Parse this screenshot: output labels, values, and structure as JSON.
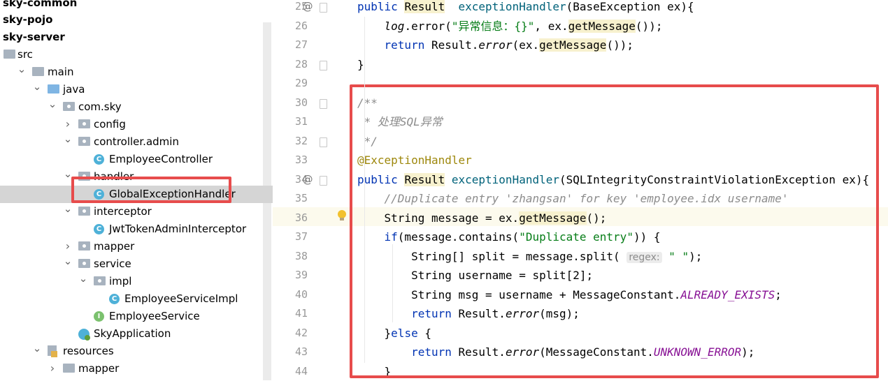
{
  "tree": [
    {
      "label": "sky-common",
      "bold": true
    },
    {
      "label": "sky-pojo",
      "bold": true
    },
    {
      "label": "sky-server",
      "bold": true
    },
    {
      "label": "src",
      "icon": "folder"
    },
    {
      "label": "main",
      "icon": "folder",
      "arrow": "down"
    },
    {
      "label": "java",
      "icon": "folder-blue",
      "arrow": "down"
    },
    {
      "label": "com.sky",
      "icon": "package",
      "arrow": "down"
    },
    {
      "label": "config",
      "icon": "package",
      "arrow": "right"
    },
    {
      "label": "controller.admin",
      "icon": "package",
      "arrow": "down"
    },
    {
      "label": "EmployeeController",
      "icon": "class"
    },
    {
      "label": "handler",
      "icon": "package",
      "arrow": "down"
    },
    {
      "label": "GlobalExceptionHandler",
      "icon": "class",
      "selected": true
    },
    {
      "label": "interceptor",
      "icon": "package",
      "arrow": "down"
    },
    {
      "label": "JwtTokenAdminInterceptor",
      "icon": "class"
    },
    {
      "label": "mapper",
      "icon": "package",
      "arrow": "right"
    },
    {
      "label": "service",
      "icon": "package",
      "arrow": "down"
    },
    {
      "label": "impl",
      "icon": "package",
      "arrow": "down"
    },
    {
      "label": "EmployeeServiceImpl",
      "icon": "class"
    },
    {
      "label": "EmployeeService",
      "icon": "interface"
    },
    {
      "label": "SkyApplication",
      "icon": "app"
    },
    {
      "label": "resources",
      "icon": "resources",
      "arrow": "down"
    },
    {
      "label": "mapper",
      "icon": "folder",
      "arrow": "right"
    }
  ],
  "editor": {
    "line_numbers": [
      "25",
      "26",
      "27",
      "28",
      "29",
      "30",
      "31",
      "32",
      "33",
      "34",
      "35",
      "36",
      "37",
      "38",
      "39",
      "40",
      "41",
      "42",
      "43",
      "44"
    ],
    "gutter_marks": {
      "25": "@",
      "34": "@"
    },
    "lines": [
      [
        [
          "kw",
          "public "
        ],
        [
          "hl",
          "Result"
        ],
        [
          "",
          "  "
        ],
        [
          "fn",
          "exceptionHandler"
        ],
        [
          "",
          "(BaseException ex){"
        ]
      ],
      [
        [
          "",
          "    "
        ],
        [
          "ital",
          "log"
        ],
        [
          "",
          ".error("
        ],
        [
          "str",
          "\"异常信息：{}\""
        ],
        [
          "",
          ", ex."
        ],
        [
          "hl",
          "getMessage"
        ],
        [
          "",
          "());"
        ]
      ],
      [
        [
          "",
          "    "
        ],
        [
          "kw",
          "return "
        ],
        [
          "",
          "Result."
        ],
        [
          "ital",
          "error"
        ],
        [
          "",
          "(ex."
        ],
        [
          "hl",
          "getMessage"
        ],
        [
          "",
          "());"
        ]
      ],
      [
        [
          "",
          "}"
        ]
      ],
      [
        [
          "",
          ""
        ]
      ],
      [
        [
          "cmt",
          "/**"
        ]
      ],
      [
        [
          "cmt",
          " * 处理SQL异常"
        ]
      ],
      [
        [
          "cmt",
          " */"
        ]
      ],
      [
        [
          "ann",
          "@ExceptionHandler"
        ]
      ],
      [
        [
          "kw",
          "public "
        ],
        [
          "hl",
          "Result"
        ],
        [
          "",
          ""
        ],
        [
          "fn",
          " exceptionHandler"
        ],
        [
          "",
          "(SQLIntegrityConstraintViolationException ex){"
        ]
      ],
      [
        [
          "",
          "    "
        ],
        [
          "cmt",
          "//Duplicate entry 'zhangsan' for key 'employee.idx username'"
        ]
      ],
      [
        [
          "",
          "    String message = ex."
        ],
        [
          "hl",
          "getMessage"
        ],
        [
          "",
          "();"
        ]
      ],
      [
        [
          "",
          "    "
        ],
        [
          "kw",
          "if"
        ],
        [
          "",
          "(message.contains("
        ],
        [
          "str",
          "\"Duplicate entry\""
        ],
        [
          "",
          ")) {"
        ]
      ],
      [
        [
          "",
          "        String[] split = message.split( "
        ],
        [
          "hint",
          "regex:"
        ],
        [
          "str",
          " \" \""
        ],
        [
          "",
          ");"
        ]
      ],
      [
        [
          "",
          "        String username = split[2];"
        ]
      ],
      [
        [
          "",
          "        String msg = username + MessageConstant."
        ],
        [
          "const",
          "ALREADY_EXISTS"
        ],
        [
          "",
          ";"
        ]
      ],
      [
        [
          "",
          "        "
        ],
        [
          "kw",
          "return "
        ],
        [
          "",
          "Result."
        ],
        [
          "ital",
          "error"
        ],
        [
          "",
          "(msg);"
        ]
      ],
      [
        [
          "",
          "    }"
        ],
        [
          "kw",
          "else "
        ],
        [
          "",
          "{"
        ]
      ],
      [
        [
          "",
          "        "
        ],
        [
          "kw",
          "return "
        ],
        [
          "",
          "Result."
        ],
        [
          "ital",
          "error"
        ],
        [
          "",
          "(MessageConstant."
        ],
        [
          "const",
          "UNKNOWN_ERROR"
        ],
        [
          "",
          ");"
        ]
      ],
      [
        [
          "",
          "    }"
        ]
      ]
    ]
  },
  "colors": {
    "highlight_box": "#e74c4c",
    "selected_row": "#d5d5d5",
    "current_line": "#fcfaed"
  }
}
